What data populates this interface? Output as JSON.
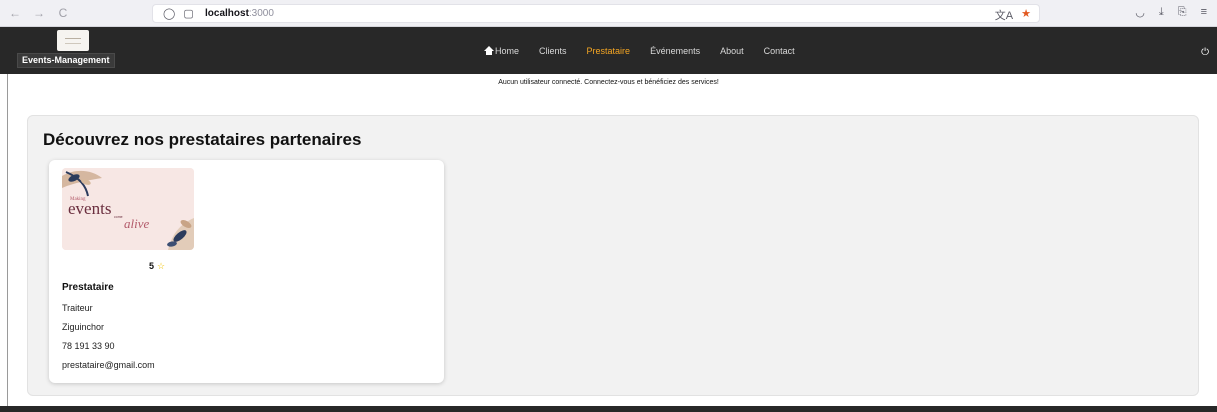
{
  "browser": {
    "nav_back": "←",
    "nav_forward": "→",
    "nav_reload": "C",
    "url_host": "localhost",
    "url_port": ":3000",
    "icons": [
      "shield-icon",
      "page-icon",
      "translate-icon",
      "bookmark-star-icon",
      "pocket-icon",
      "download-icon",
      "extensions-icon",
      "menu-icon"
    ]
  },
  "navbar": {
    "brand": "Events-Management",
    "items": [
      {
        "label": "Home",
        "active": false
      },
      {
        "label": "Clients",
        "active": false
      },
      {
        "label": "Prestataire",
        "active": true
      },
      {
        "label": "Événements",
        "active": false
      },
      {
        "label": "About",
        "active": false
      },
      {
        "label": "Contact",
        "active": false
      }
    ],
    "active_color": "#f5a623",
    "background": "#282828"
  },
  "notice": "Aucun utilisateur connecté. Connectez-vous et bénéficiez des services!",
  "section": {
    "title": "Découvrez nos prestataires partenaires"
  },
  "card": {
    "image_text": {
      "line1": "Making",
      "line2": "events",
      "line3": "come",
      "line4": "alive"
    },
    "rating": "5",
    "rating_star": "☆",
    "name": "Prestataire",
    "category": "Traiteur",
    "city": "Ziguinchor",
    "phone": "78 191 33 90",
    "email": "prestataire@gmail.com"
  }
}
